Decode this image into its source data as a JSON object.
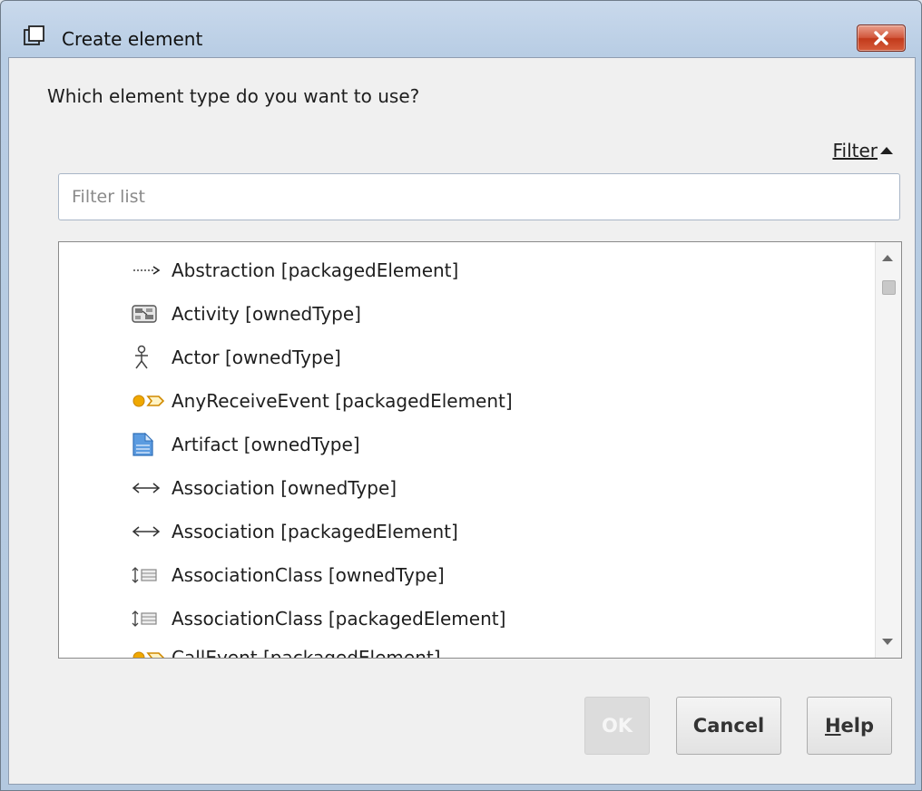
{
  "window": {
    "title": "Create element",
    "title_icon": "window-icon",
    "close_icon": "close-icon"
  },
  "dialog": {
    "question": "Which element type do you want to use?",
    "filter_link": "Filter",
    "filter_input": {
      "value": "",
      "placeholder": "Filter list"
    }
  },
  "list": {
    "items": [
      {
        "label": "Abstraction [packagedElement]",
        "icon": "abstraction-icon"
      },
      {
        "label": "Activity [ownedType]",
        "icon": "activity-icon"
      },
      {
        "label": "Actor [ownedType]",
        "icon": "actor-icon"
      },
      {
        "label": "AnyReceiveEvent [packagedElement]",
        "icon": "any-receive-event-icon"
      },
      {
        "label": "Artifact [ownedType]",
        "icon": "artifact-icon"
      },
      {
        "label": "Association [ownedType]",
        "icon": "association-icon"
      },
      {
        "label": "Association [packagedElement]",
        "icon": "association-icon"
      },
      {
        "label": "AssociationClass [ownedType]",
        "icon": "association-class-icon"
      },
      {
        "label": "AssociationClass [packagedElement]",
        "icon": "association-class-icon"
      },
      {
        "label": "CallEvent [packagedElement]",
        "icon": "call-event-icon"
      }
    ]
  },
  "buttons": {
    "ok": "OK",
    "cancel": "Cancel",
    "help_mnemonic": "H",
    "help_rest": "elp"
  },
  "colors": {
    "event_orange": "#f0a800",
    "artifact_blue": "#4a8fd6",
    "close_red": "#c8462a"
  }
}
